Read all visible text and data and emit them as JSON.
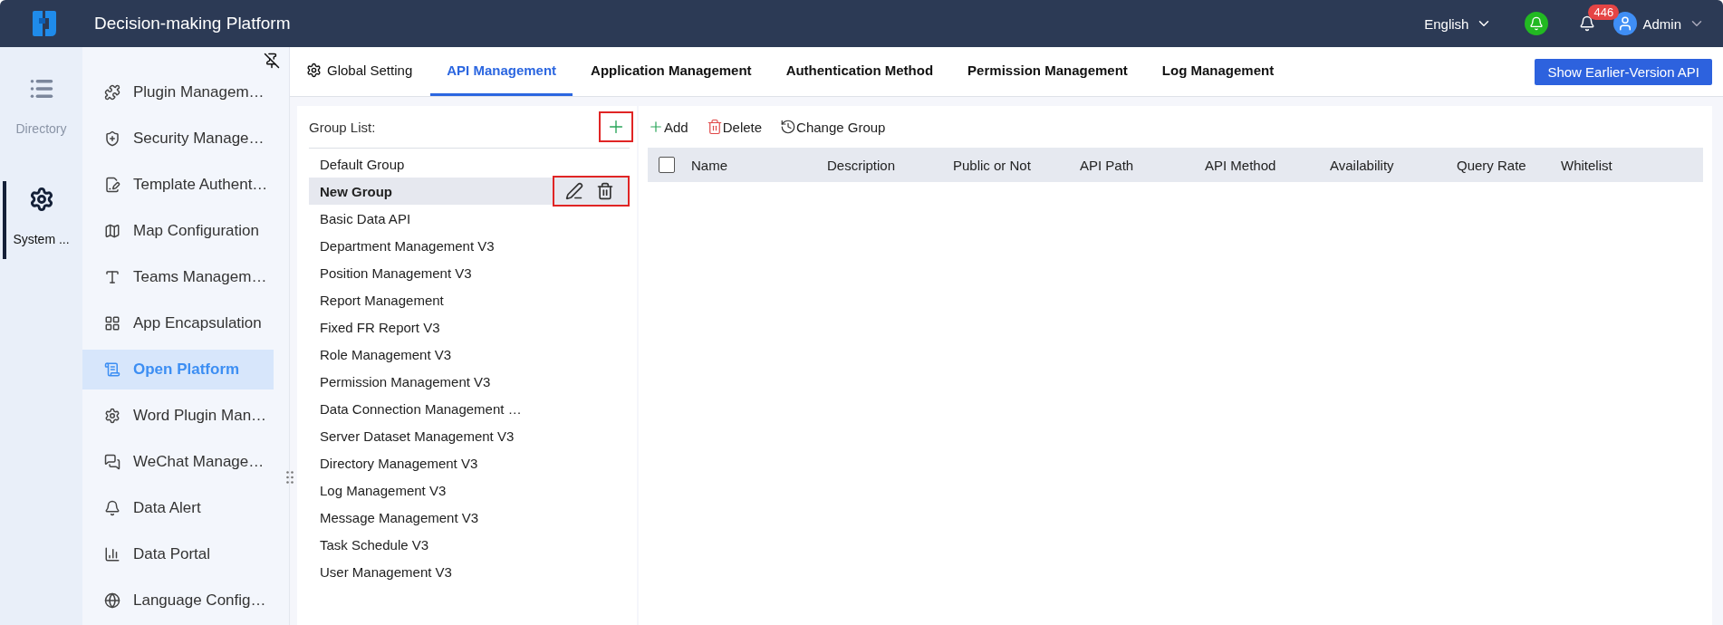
{
  "header": {
    "title": "Decision-making Platform",
    "language": "English",
    "notification_count": "446",
    "user": "Admin"
  },
  "rail": [
    {
      "label": "Directory",
      "selected": false
    },
    {
      "label": "System ...",
      "selected": true
    }
  ],
  "sidebar": {
    "items": [
      {
        "label": "Plugin Managem…",
        "selected": false
      },
      {
        "label": "Security Manage…",
        "selected": false
      },
      {
        "label": "Template Authent…",
        "selected": false
      },
      {
        "label": "Map Configuration",
        "selected": false
      },
      {
        "label": "Teams Managem…",
        "selected": false
      },
      {
        "label": "App Encapsulation",
        "selected": false
      },
      {
        "label": "Open Platform",
        "selected": true
      },
      {
        "label": "Word Plugin Man…",
        "selected": false
      },
      {
        "label": "WeChat Manage…",
        "selected": false
      },
      {
        "label": "Data Alert",
        "selected": false
      },
      {
        "label": "Data Portal",
        "selected": false
      },
      {
        "label": "Language Config…",
        "selected": false
      }
    ]
  },
  "tabs": [
    {
      "label": "Global Setting",
      "kind": "settings",
      "selected": false
    },
    {
      "label": "API Management",
      "kind": "plain",
      "selected": true
    },
    {
      "label": "Application Management",
      "kind": "plain",
      "selected": false
    },
    {
      "label": "Authentication Method",
      "kind": "plain",
      "selected": false
    },
    {
      "label": "Permission Management",
      "kind": "plain",
      "selected": false
    },
    {
      "label": "Log Management",
      "kind": "plain",
      "selected": false
    }
  ],
  "earlier_version_button": "Show Earlier-Version API",
  "group_list": {
    "title": "Group List:",
    "add_highlighted": true,
    "groups": [
      {
        "label": "Default Group",
        "selected": false
      },
      {
        "label": "New Group",
        "selected": true,
        "actions_highlighted": true
      },
      {
        "label": "Basic Data API",
        "selected": false
      },
      {
        "label": "Department Management V3",
        "selected": false
      },
      {
        "label": "Position Management V3",
        "selected": false
      },
      {
        "label": "Report Management",
        "selected": false
      },
      {
        "label": "Fixed FR Report V3",
        "selected": false
      },
      {
        "label": "Role Management V3",
        "selected": false
      },
      {
        "label": "Permission Management V3",
        "selected": false
      },
      {
        "label": "Data Connection Management …",
        "selected": false
      },
      {
        "label": "Server Dataset Management V3",
        "selected": false
      },
      {
        "label": "Directory Management V3",
        "selected": false
      },
      {
        "label": "Log Management V3",
        "selected": false
      },
      {
        "label": "Message Management V3",
        "selected": false
      },
      {
        "label": "Task Schedule V3",
        "selected": false
      },
      {
        "label": "User Management V3",
        "selected": false
      }
    ]
  },
  "toolbar": [
    {
      "label": "Add",
      "kind": "add"
    },
    {
      "label": "Delete",
      "kind": "delete"
    },
    {
      "label": "Change Group",
      "kind": "change"
    }
  ],
  "table": {
    "select_all_checked": false,
    "columns": [
      "Name",
      "Description",
      "Public or Not",
      "API Path",
      "API Method",
      "Availability",
      "Query Rate",
      "Whitelist"
    ]
  }
}
